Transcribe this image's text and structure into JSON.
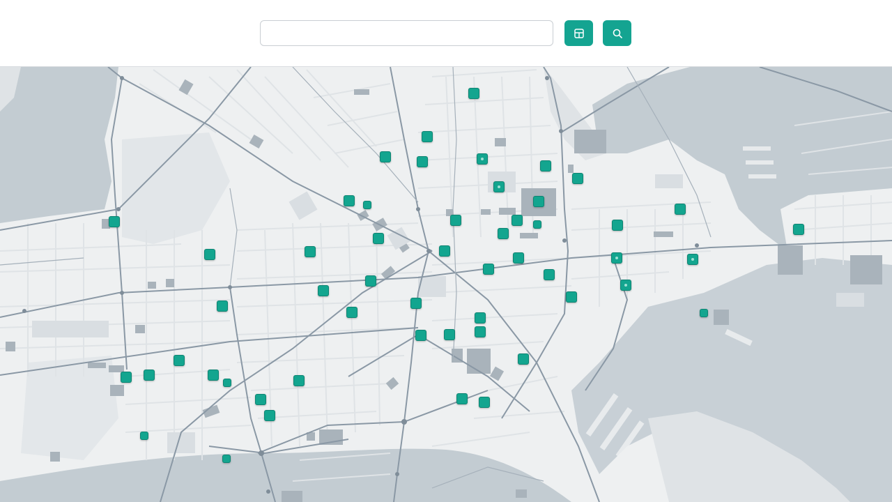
{
  "search": {
    "value": "",
    "placeholder": ""
  },
  "toolbar": {
    "layers_icon": "layers-grid-icon",
    "search_icon": "magnifier-icon"
  },
  "colors": {
    "accent": "#13a58f",
    "water": "#c3ccd2",
    "land": "#eef0f1",
    "road": "#8a98a5",
    "building": "#a9b3bb"
  },
  "map": {
    "marker_count": 57
  }
}
